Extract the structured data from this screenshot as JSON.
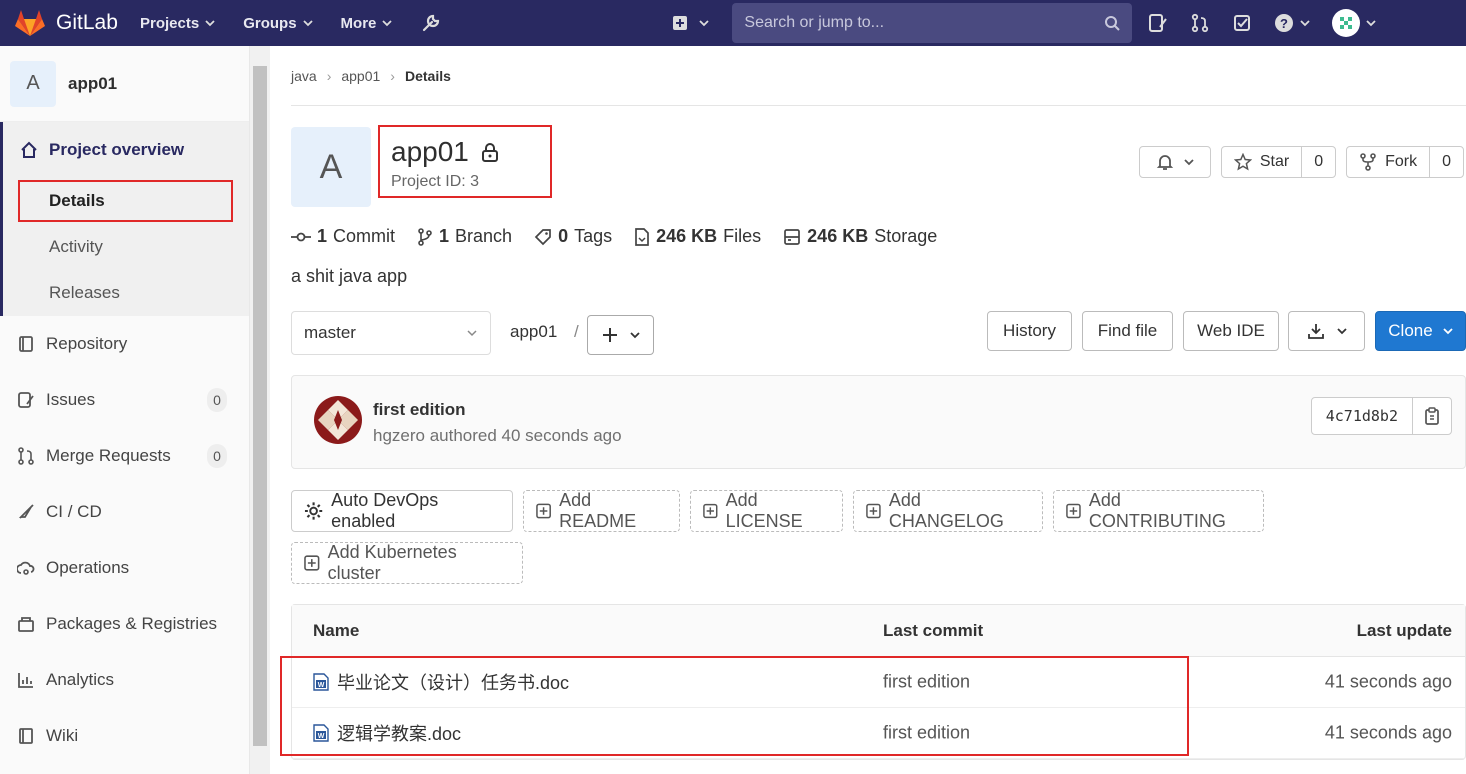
{
  "topbar": {
    "brand": "GitLab",
    "nav": [
      {
        "label": "Projects"
      },
      {
        "label": "Groups"
      },
      {
        "label": "More"
      }
    ],
    "search_placeholder": "Search or jump to..."
  },
  "sidebar": {
    "project_letter": "A",
    "project_name": "app01",
    "overview": {
      "label": "Project overview",
      "children": [
        "Details",
        "Activity",
        "Releases"
      ]
    },
    "items": [
      {
        "label": "Repository",
        "icon": "repository-icon"
      },
      {
        "label": "Issues",
        "icon": "issues-icon",
        "count": "0"
      },
      {
        "label": "Merge Requests",
        "icon": "merge-request-icon",
        "count": "0"
      },
      {
        "label": "CI / CD",
        "icon": "rocket-icon"
      },
      {
        "label": "Operations",
        "icon": "cloud-gear-icon"
      },
      {
        "label": "Packages & Registries",
        "icon": "package-icon"
      },
      {
        "label": "Analytics",
        "icon": "chart-icon"
      },
      {
        "label": "Wiki",
        "icon": "book-icon"
      }
    ]
  },
  "breadcrumb": [
    "java",
    "app01",
    "Details"
  ],
  "project": {
    "letter": "A",
    "name": "app01",
    "id_text": "Project ID: 3",
    "description": "a shit java app"
  },
  "header_buttons": {
    "star_label": "Star",
    "star_count": "0",
    "fork_label": "Fork",
    "fork_count": "0"
  },
  "stats": [
    {
      "value": "1",
      "label": "Commit"
    },
    {
      "value": "1",
      "label": "Branch"
    },
    {
      "value": "0",
      "label": "Tags"
    },
    {
      "value": "246 KB",
      "label": "Files"
    },
    {
      "value": "246 KB",
      "label": "Storage"
    }
  ],
  "repo_bar": {
    "branch": "master",
    "path": "app01",
    "path_sep": "/",
    "history": "History",
    "find_file": "Find file",
    "web_ide": "Web IDE",
    "clone": "Clone"
  },
  "last_commit": {
    "title": "first edition",
    "meta": "hgzero authored 40 seconds ago",
    "sha": "4c71d8b2"
  },
  "actions": [
    "Auto DevOps enabled",
    "Add README",
    "Add LICENSE",
    "Add CHANGELOG",
    "Add CONTRIBUTING",
    "Add Kubernetes cluster"
  ],
  "file_table": {
    "headers": {
      "name": "Name",
      "commit": "Last commit",
      "update": "Last update"
    },
    "rows": [
      {
        "name": "毕业论文（设计）任务书.doc",
        "commit": "first edition",
        "update": "41 seconds ago"
      },
      {
        "name": "逻辑学教案.doc",
        "commit": "first edition",
        "update": "41 seconds ago"
      }
    ]
  },
  "colors": {
    "topbar": "#292961",
    "clone_button": "#1f78d1",
    "highlight_box": "#e02828"
  }
}
